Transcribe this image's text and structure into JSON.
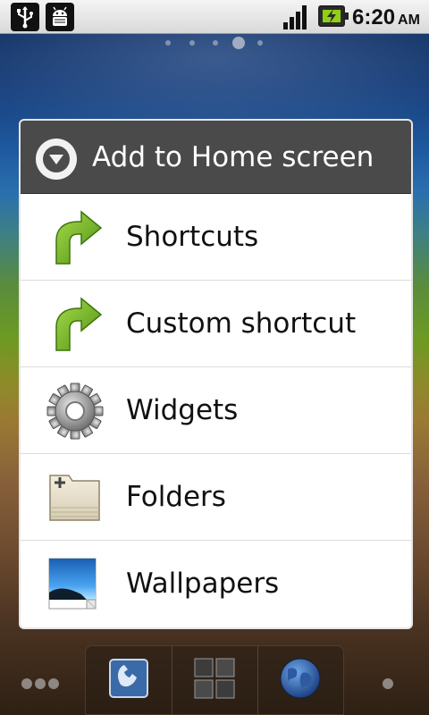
{
  "status_bar": {
    "time": "6:20",
    "ampm": "AM",
    "icons": [
      "usb-icon",
      "debug-android-icon",
      "signal-icon",
      "battery-charging-icon"
    ]
  },
  "home": {
    "page_count": 5,
    "active_page": 4
  },
  "dialog": {
    "title": "Add to Home screen",
    "title_icon": "chevron-down-circle-icon",
    "items": [
      {
        "label": "Shortcuts",
        "icon": "green-arrow-icon"
      },
      {
        "label": "Custom shortcut",
        "icon": "green-arrow-icon"
      },
      {
        "label": "Widgets",
        "icon": "gear-icon"
      },
      {
        "label": "Folders",
        "icon": "folder-add-icon"
      },
      {
        "label": "Wallpapers",
        "icon": "wallpaper-picture-icon"
      }
    ]
  },
  "dock": {
    "buttons": [
      "phone-icon",
      "app-drawer-icon",
      "browser-globe-icon"
    ]
  },
  "colors": {
    "accent_green": "#6ab41e",
    "header_gray": "#4a4a4a"
  }
}
